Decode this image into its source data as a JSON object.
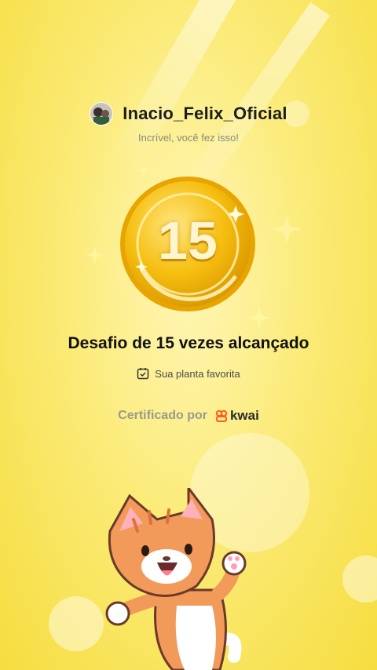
{
  "user": {
    "name": "Inacio_Felix_Oficial"
  },
  "subtitle": "Incrível, você fez isso!",
  "medal": {
    "number": "15"
  },
  "achievement": {
    "title": "Desafio de 15 vezes alcançado"
  },
  "tag": {
    "label": "Sua planta favorita",
    "icon": "calendar-check-icon"
  },
  "certification": {
    "label": "Certificado por",
    "brand": "kwai",
    "brand_color": "#ff5a1f"
  },
  "colors": {
    "background": "#fbeb78",
    "medal_gold": "#f2b600"
  }
}
